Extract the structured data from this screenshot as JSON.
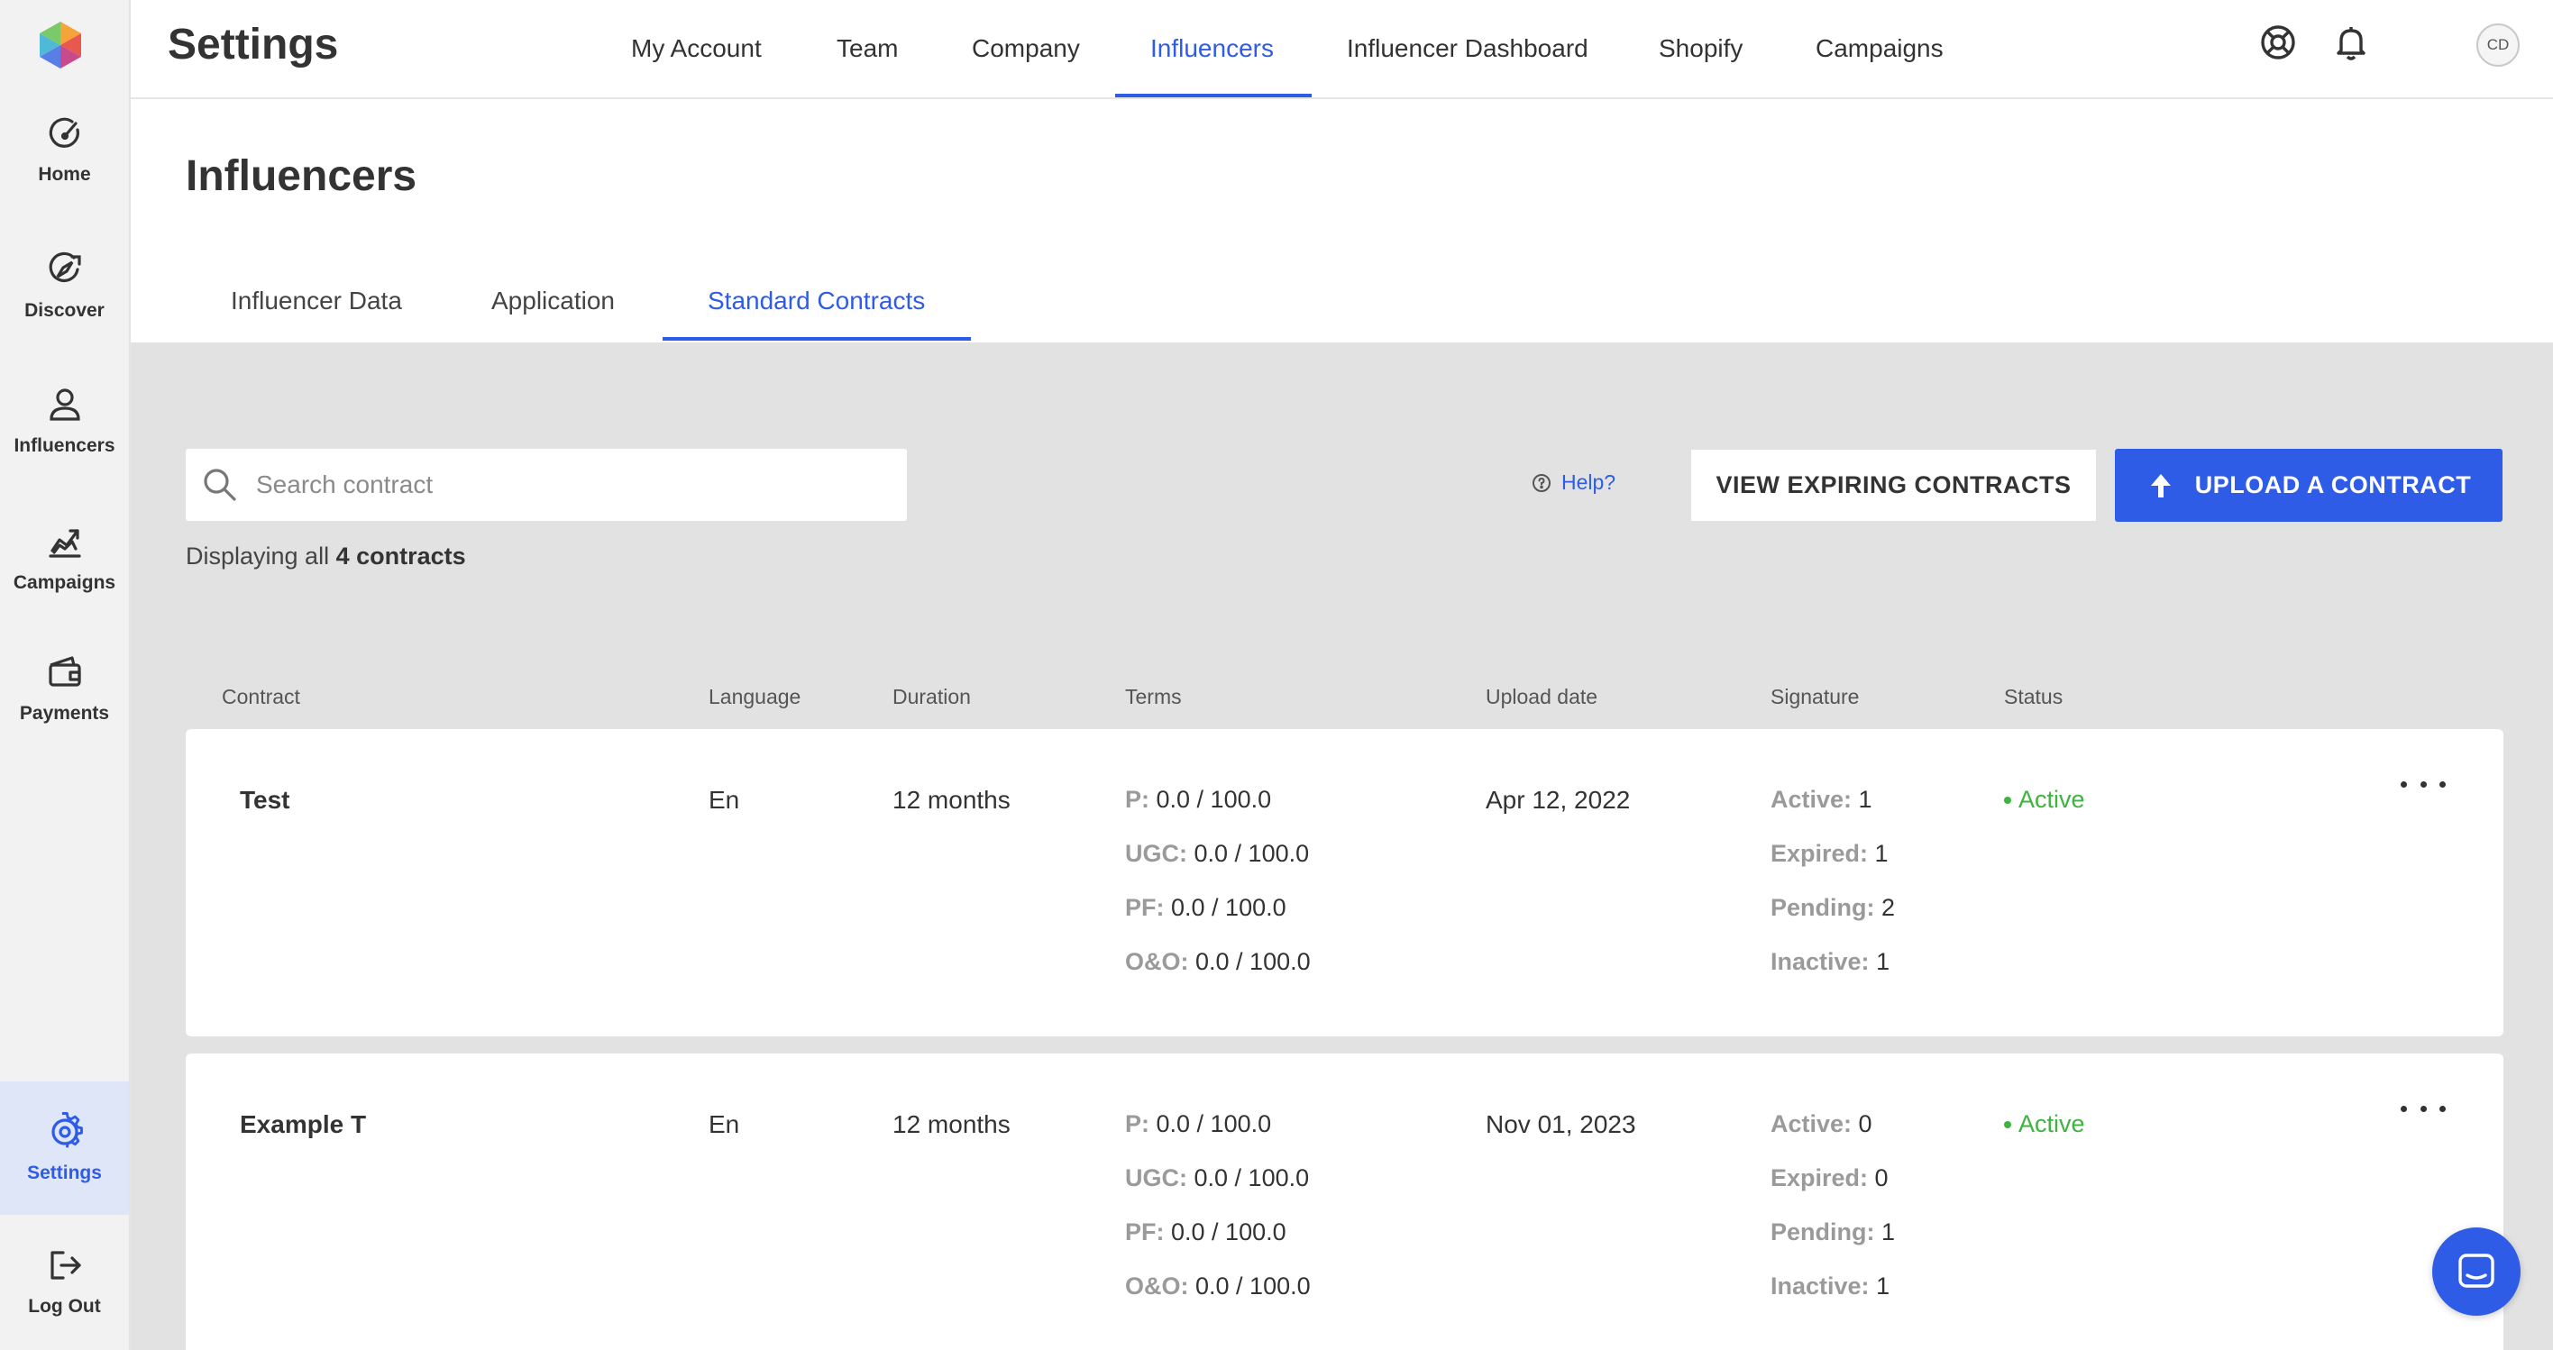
{
  "sidebar": {
    "items": [
      {
        "label": "Home",
        "icon": "home-gauge-icon"
      },
      {
        "label": "Discover",
        "icon": "discover-compass-icon"
      },
      {
        "label": "Influencers",
        "icon": "person-icon"
      },
      {
        "label": "Campaigns",
        "icon": "chart-icon"
      },
      {
        "label": "Payments",
        "icon": "wallet-icon"
      },
      {
        "label": "Settings",
        "icon": "gear-icon"
      },
      {
        "label": "Log Out",
        "icon": "logout-icon"
      }
    ],
    "active": "Settings"
  },
  "header": {
    "title": "Settings",
    "tabs": [
      "My Account",
      "Team",
      "Company",
      "Influencers",
      "Influencer Dashboard",
      "Shopify",
      "Campaigns"
    ],
    "active_tab": "Influencers",
    "avatar_initials": "CD"
  },
  "page": {
    "title": "Influencers",
    "tabs": [
      "Influencer Data",
      "Application",
      "Standard Contracts"
    ],
    "active_tab": "Standard Contracts"
  },
  "toolbar": {
    "search_placeholder": "Search contract",
    "help_label": "Help?",
    "expiring_label": "VIEW EXPIRING CONTRACTS",
    "upload_label": "UPLOAD A CONTRACT",
    "count_prefix": "Displaying all",
    "count_value": "4 contracts"
  },
  "table": {
    "columns": [
      "Contract",
      "Language",
      "Duration",
      "Terms",
      "Upload date",
      "Signature",
      "Status"
    ],
    "rows": [
      {
        "contract": "Test",
        "language": "En",
        "duration": "12 months",
        "terms": [
          {
            "k": "P:",
            "v": "0.0 / 100.0"
          },
          {
            "k": "UGC:",
            "v": "0.0 / 100.0"
          },
          {
            "k": "PF:",
            "v": "0.0 / 100.0"
          },
          {
            "k": "O&O:",
            "v": "0.0 / 100.0"
          }
        ],
        "upload_date": "Apr 12, 2022",
        "signature": [
          {
            "k": "Active:",
            "v": "1"
          },
          {
            "k": "Expired:",
            "v": "1"
          },
          {
            "k": "Pending:",
            "v": "2"
          },
          {
            "k": "Inactive:",
            "v": "1"
          }
        ],
        "status": "Active"
      },
      {
        "contract": "Example T",
        "language": "En",
        "duration": "12 months",
        "terms": [
          {
            "k": "P:",
            "v": "0.0 / 100.0"
          },
          {
            "k": "UGC:",
            "v": "0.0 / 100.0"
          },
          {
            "k": "PF:",
            "v": "0.0 / 100.0"
          },
          {
            "k": "O&O:",
            "v": "0.0 / 100.0"
          }
        ],
        "upload_date": "Nov 01, 2023",
        "signature": [
          {
            "k": "Active:",
            "v": "0"
          },
          {
            "k": "Expired:",
            "v": "0"
          },
          {
            "k": "Pending:",
            "v": "1"
          },
          {
            "k": "Inactive:",
            "v": "1"
          }
        ],
        "status": "Active"
      }
    ]
  },
  "colors": {
    "accent": "#2f5ce6",
    "status_active": "#3db43d",
    "content_bg": "#e2e2e2",
    "sidebar_bg": "#f2f2f2"
  }
}
